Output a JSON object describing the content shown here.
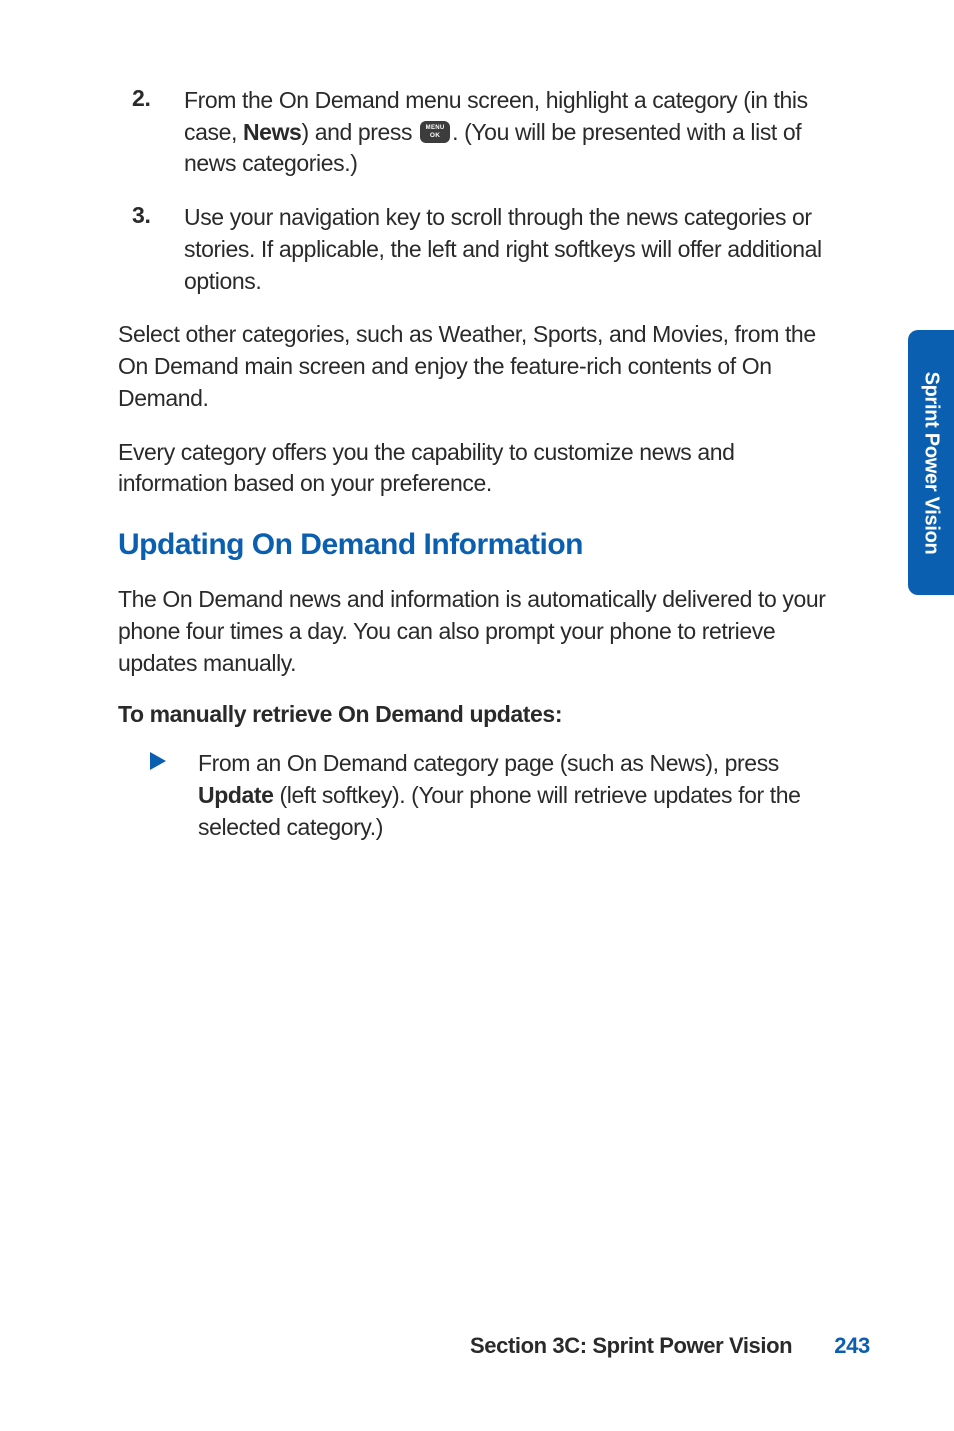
{
  "section_tab": "Sprint Power Vision",
  "steps": [
    {
      "num": "2.",
      "pre": "From the On Demand menu screen, highlight a category (in this case, ",
      "bold1": "News",
      "mid": ") and press ",
      "post": ". (You will be presented with a list of news categories.)"
    },
    {
      "num": "3.",
      "text": "Use your navigation key to scroll through the news categories or stories. If applicable, the left and right softkeys will offer additional options."
    }
  ],
  "para1": "Select other categories, such as Weather, Sports, and Movies, from the On Demand main screen and enjoy the feature-rich contents of On Demand.",
  "para2": "Every category offers you the capability to customize news and information based on your preference.",
  "heading": "Updating On Demand Information",
  "para3": "The On Demand news and information is automatically delivered to your phone four times a day. You can also prompt your phone to retrieve updates manually.",
  "subheading": "To manually retrieve On Demand updates:",
  "bullet": {
    "pre": "From an On Demand category page (such as News), press ",
    "bold": "Update",
    "post": " (left softkey). (Your phone will retrieve updates for the selected category.)"
  },
  "footer": {
    "section": "Section 3C: Sprint Power Vision",
    "page": "243"
  }
}
